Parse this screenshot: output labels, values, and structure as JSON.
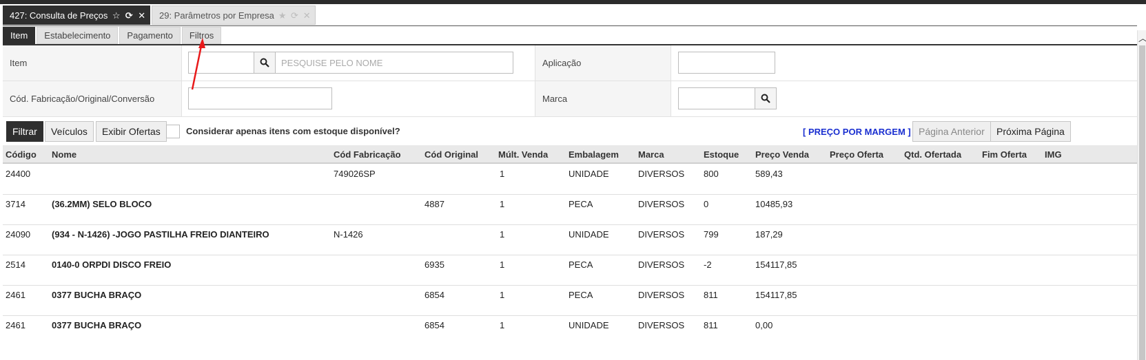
{
  "window_tabs": [
    {
      "label": "427: Consulta de Preços",
      "active": true
    },
    {
      "label": "29: Parâmetros por Empresa",
      "active": false
    }
  ],
  "sub_tabs": [
    "Item",
    "Estabelecimento",
    "Pagamento",
    "Filtros"
  ],
  "form": {
    "item_label": "Item",
    "item_name_placeholder": "PESQUISE PELO NOME",
    "aplicacao_label": "Aplicação",
    "cod_label": "Cód. Fabricação/Original/Conversão",
    "marca_label": "Marca"
  },
  "toolbar": {
    "filtrar": "Filtrar",
    "veiculos": "Veículos",
    "exibir_ofertas": "Exibir Ofertas",
    "estoque_checkbox_label": "Considerar apenas itens com estoque disponível?",
    "preco_margem": "[ PREÇO POR MARGEM ]",
    "pagina_anterior": "Página Anterior",
    "proxima_pagina": "Próxima Página"
  },
  "table": {
    "headers": [
      "Código",
      "Nome",
      "Cód Fabricação",
      "Cód Original",
      "Múlt. Venda",
      "Embalagem",
      "Marca",
      "Estoque",
      "Preço Venda",
      "Preço Oferta",
      "Qtd. Ofertada",
      "Fim Oferta",
      "IMG"
    ],
    "rows": [
      {
        "codigo": "24400",
        "nome": "",
        "cod_fabricacao": "749026SP",
        "cod_original": "",
        "mult_venda": "1",
        "embalagem": "UNIDADE",
        "marca": "DIVERSOS",
        "estoque": "800",
        "preco_venda": "589,43"
      },
      {
        "codigo": "3714",
        "nome": "(36.2MM) SELO BLOCO",
        "cod_fabricacao": "",
        "cod_original": "4887",
        "mult_venda": "1",
        "embalagem": "PECA",
        "marca": "DIVERSOS",
        "estoque": "0",
        "preco_venda": "10485,93"
      },
      {
        "codigo": "24090",
        "nome": "(934 - N-1426) -JOGO PASTILHA FREIO DIANTEIRO",
        "cod_fabricacao": "N-1426",
        "cod_original": "",
        "mult_venda": "1",
        "embalagem": "UNIDADE",
        "marca": "DIVERSOS",
        "estoque": "799",
        "preco_venda": "187,29"
      },
      {
        "codigo": "2514",
        "nome": "0140-0 ORPDI DISCO FREIO",
        "cod_fabricacao": "",
        "cod_original": "6935",
        "mult_venda": "1",
        "embalagem": "PECA",
        "marca": "DIVERSOS",
        "estoque": "-2",
        "preco_venda": "154117,85"
      },
      {
        "codigo": "2461",
        "nome": "0377 BUCHA BRAÇO",
        "cod_fabricacao": "",
        "cod_original": "6854",
        "mult_venda": "1",
        "embalagem": "PECA",
        "marca": "DIVERSOS",
        "estoque": "811",
        "preco_venda": "154117,85"
      },
      {
        "codigo": "2461",
        "nome": "0377 BUCHA BRAÇO",
        "cod_fabricacao": "",
        "cod_original": "6854",
        "mult_venda": "1",
        "embalagem": "UNIDADE",
        "marca": "DIVERSOS",
        "estoque": "811",
        "preco_venda": "0,00"
      }
    ]
  },
  "colors": {
    "dark": "#2f2f2f",
    "accent_link": "#1a2fd0",
    "annotation_arrow": "#e8191a"
  }
}
